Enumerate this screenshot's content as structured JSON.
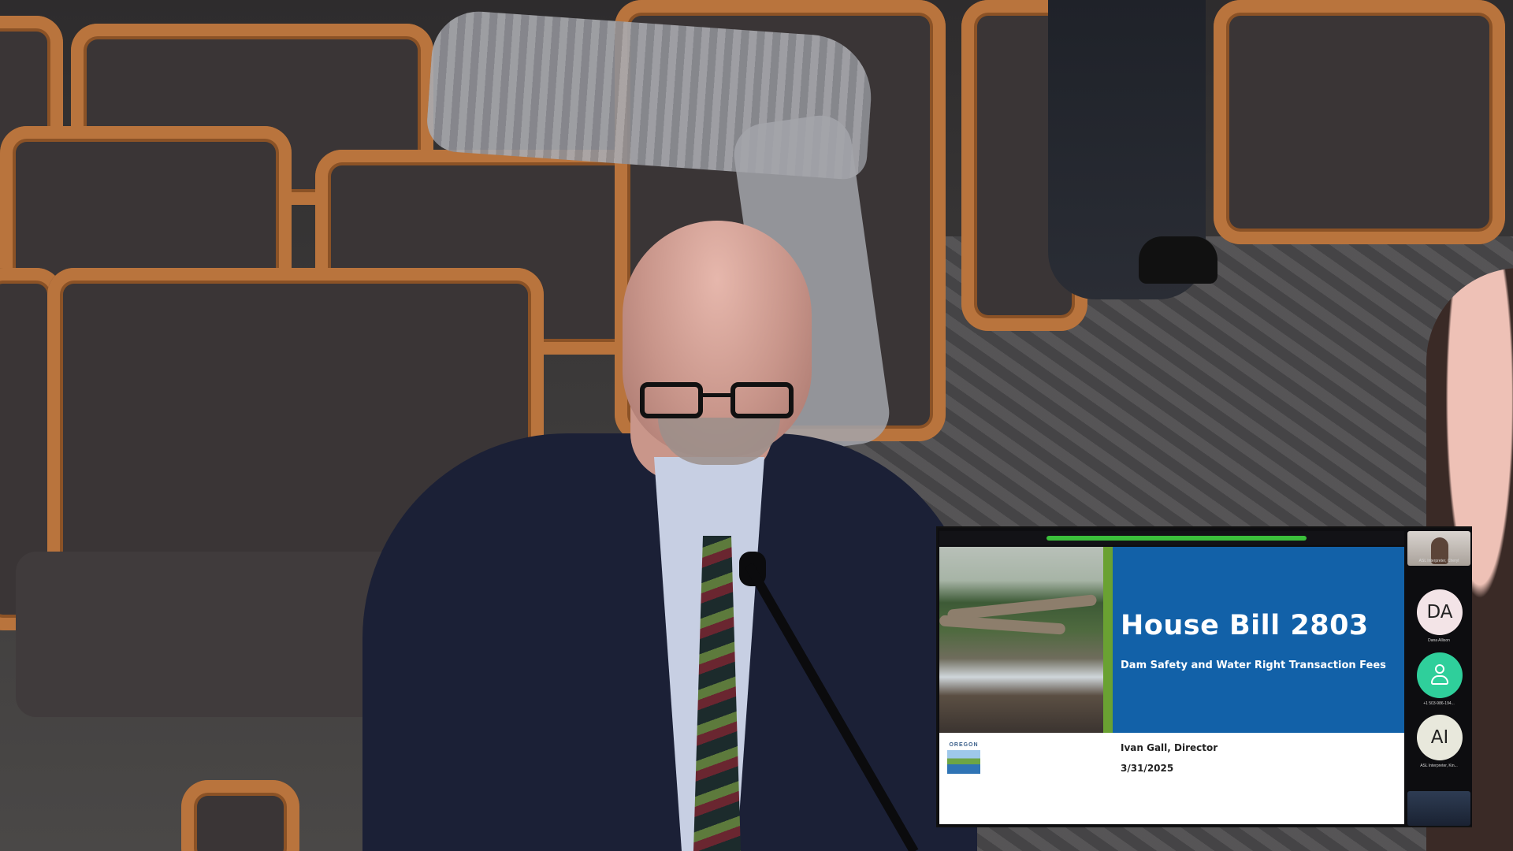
{
  "slide": {
    "title": "House Bill 2803",
    "subtitle": "Dam Safety and Water Right Transaction Fees",
    "presenter": "Ivan Gall, Director",
    "date": "3/31/2025",
    "logo_word": "OREGON",
    "logo_icon": "oregon-state-seal-icon",
    "accent_color": "#1261a8",
    "divider_color": "#6aa132"
  },
  "participants": [
    {
      "kind": "video",
      "label": "ASL Interpreter, Cheryl"
    },
    {
      "kind": "avatar",
      "initials": "DA",
      "label": "Dana Allison"
    },
    {
      "kind": "avatar-icon",
      "icon": "person-icon",
      "label": "+1 503-986-194..."
    },
    {
      "kind": "avatar",
      "initials": "AI",
      "label": "ASL Interpreter, Kin..."
    },
    {
      "kind": "video",
      "label": ""
    }
  ]
}
